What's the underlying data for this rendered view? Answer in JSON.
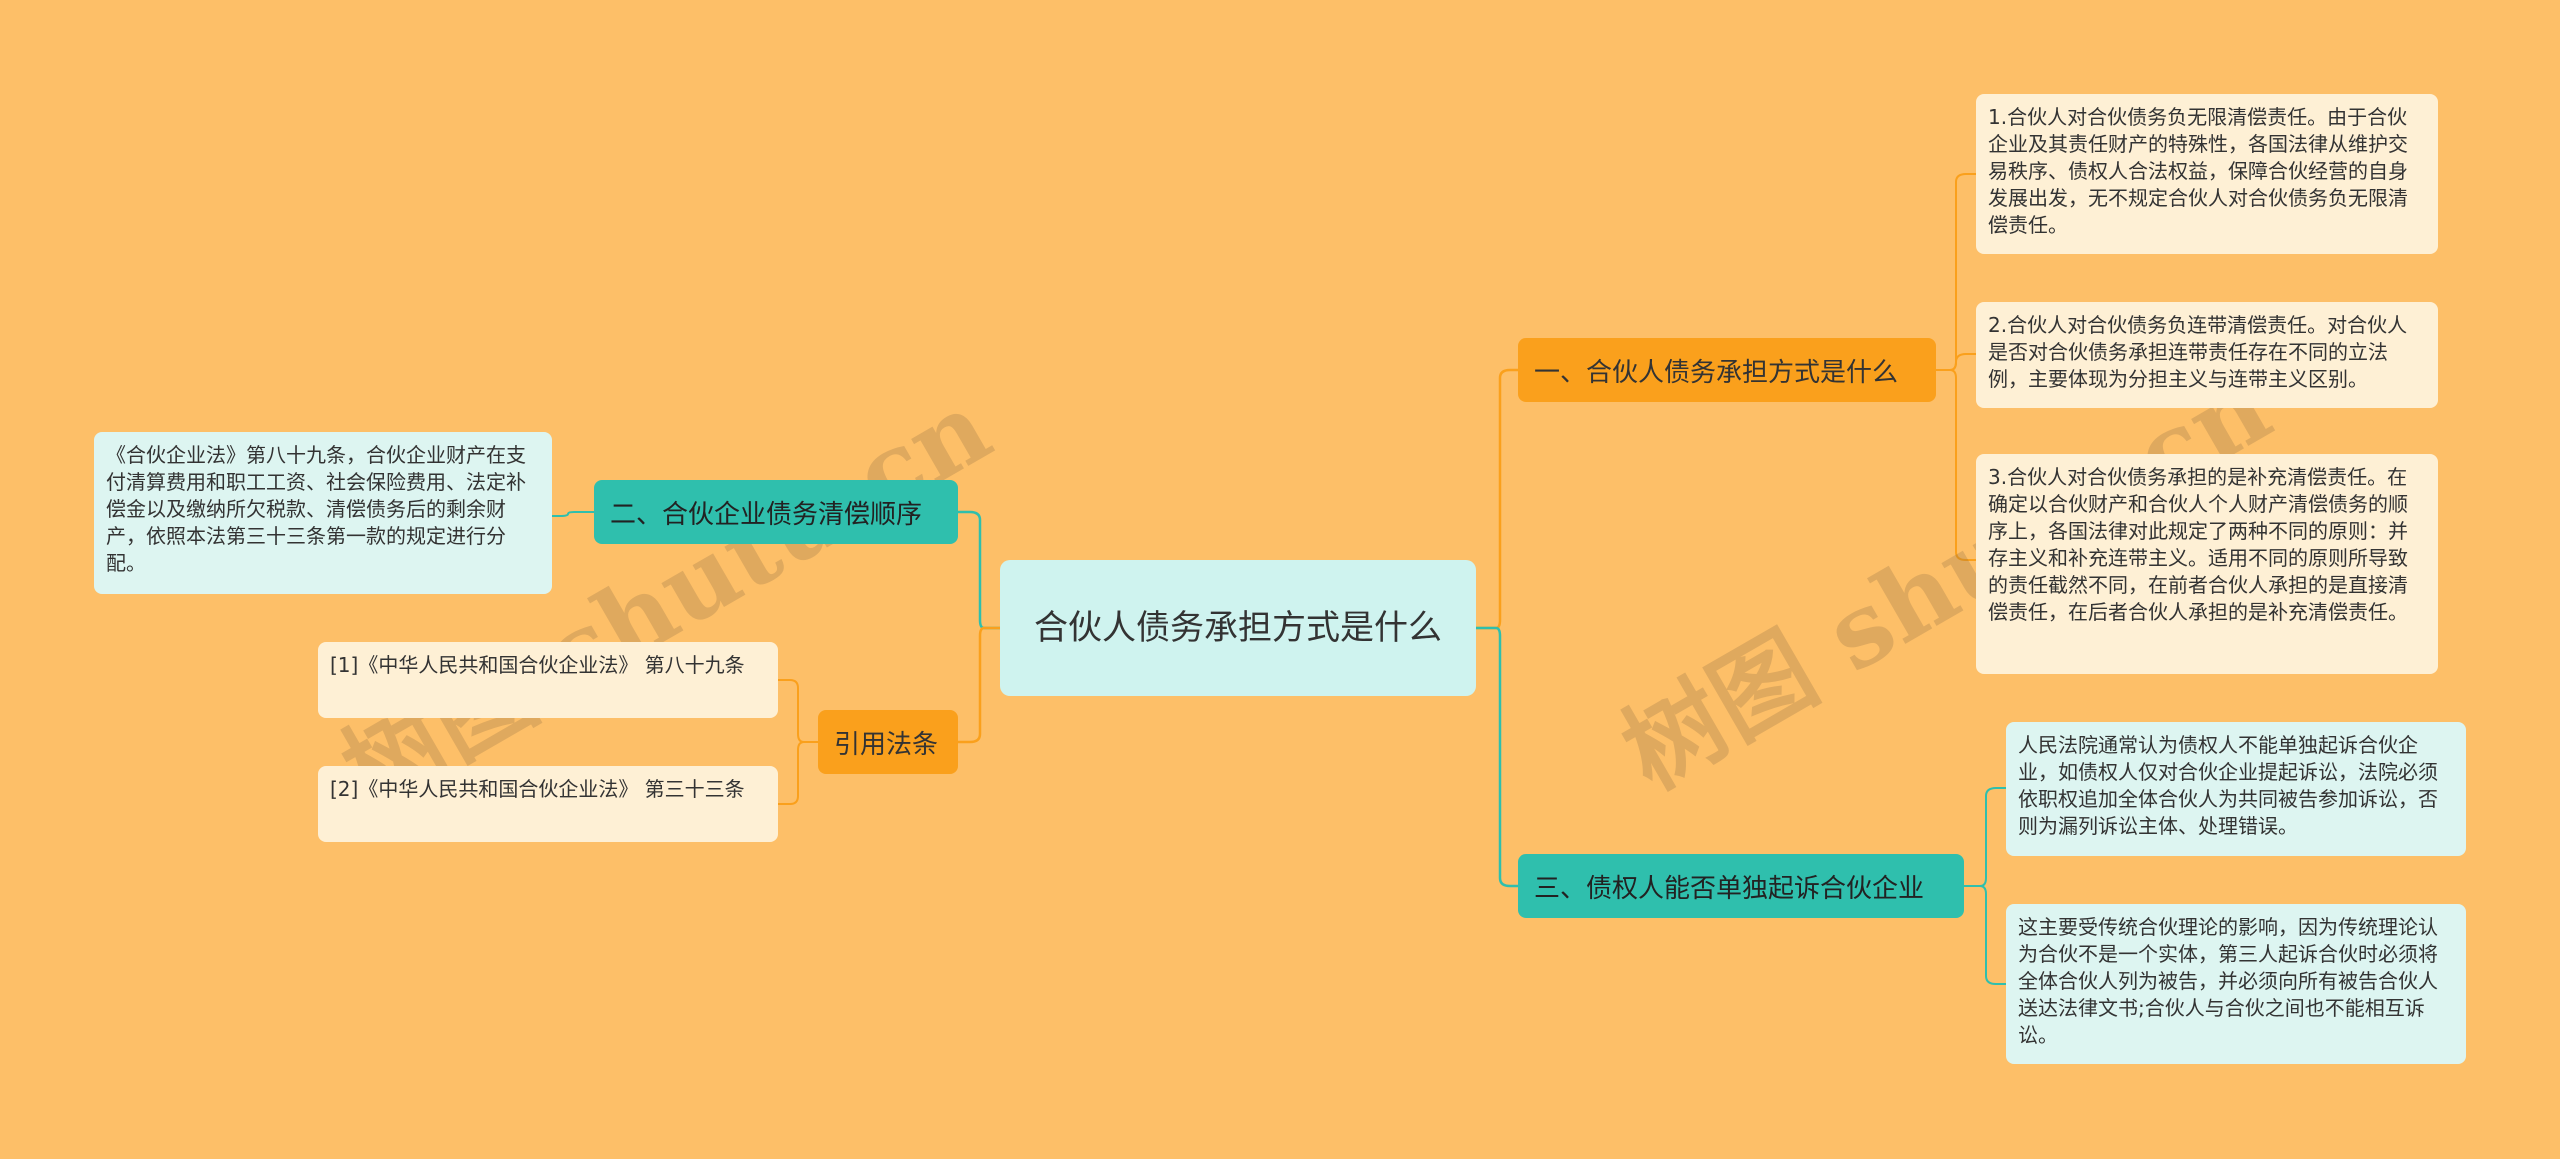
{
  "root": {
    "label": "合伙人债务承担方式是什么"
  },
  "branches": {
    "b1": {
      "label": "一、合伙人债务承担方式是什么",
      "items": [
        "1.合伙人对合伙债务负无限清偿责任。由于合伙企业及其责任财产的特殊性，各国法律从维护交易秩序、债权人合法权益，保障合伙经营的自身发展出发，无不规定合伙人对合伙债务负无限清偿责任。",
        "2.合伙人对合伙债务负连带清偿责任。对合伙人是否对合伙债务承担连带责任存在不同的立法例，主要体现为分担主义与连带主义区别。",
        "3.合伙人对合伙债务承担的是补充清偿责任。在确定以合伙财产和合伙人个人财产清偿债务的顺序上，各国法律对此规定了两种不同的原则：并存主义和补充连带主义。适用不同的原则所导致的责任截然不同，在前者合伙人承担的是直接清偿责任，在后者合伙人承担的是补充清偿责任。"
      ]
    },
    "b3": {
      "label": "三、债权人能否单独起诉合伙企业",
      "items": [
        "人民法院通常认为债权人不能单独起诉合伙企业，如债权人仅对合伙企业提起诉讼，法院必须依职权追加全体合伙人为共同被告参加诉讼，否则为漏列诉讼主体、处理错误。",
        "这主要受传统合伙理论的影响，因为传统理论认为合伙不是一个实体，第三人起诉合伙时必须将全体合伙人列为被告，并必须向所有被告合伙人送达法律文书;合伙人与合伙之间也不能相互诉讼。"
      ]
    },
    "b2": {
      "label": "二、合伙企业债务清偿顺序",
      "items": [
        "《合伙企业法》第八十九条，合伙企业财产在支付清算费用和职工工资、社会保险费用、法定补偿金以及缴纳所欠税款、清偿债务后的剩余财产，依照本法第三十三条第一款的规定进行分配。"
      ]
    },
    "b4": {
      "label": "引用法条",
      "items": [
        "[1]《中华人民共和国合伙企业法》 第八十九条",
        "[2]《中华人民共和国合伙企业法》 第三十三条"
      ]
    }
  },
  "watermark": [
    "树图 shutu.cn",
    "树图 shutu.cn"
  ],
  "colors": {
    "background": "#FDBF68",
    "root": "#CFF3EF",
    "orange_branch": "#FAA01C",
    "teal_branch": "#2FBFAD",
    "leaf_cream": "#FEF0D5",
    "leaf_mint": "#DDF5F1"
  }
}
